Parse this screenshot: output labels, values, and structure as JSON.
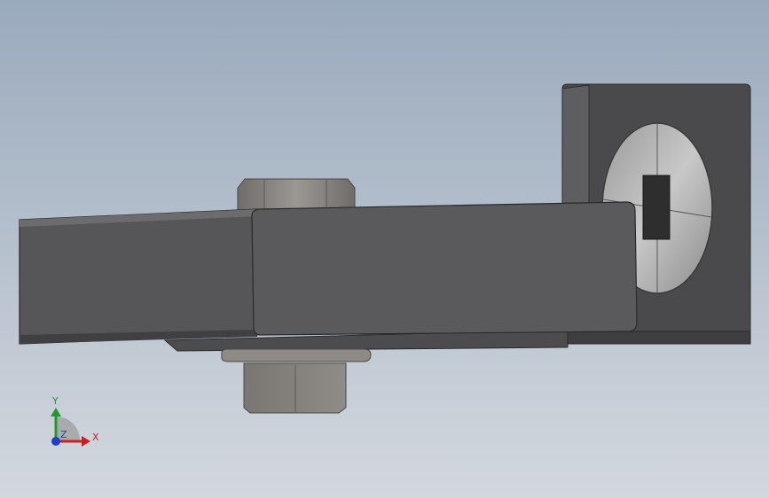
{
  "scene": {
    "background_top": "#9aaabd",
    "background_bottom": "#d3d8de",
    "model": {
      "parts": [
        "channel-beam",
        "angle-bracket",
        "hex-nut-top",
        "hex-nut-bottom",
        "washer",
        "bolt-head-slotted"
      ],
      "body_color": "#5a5a5c",
      "bracket_color": "#464648",
      "hardware_color": "#8a8784"
    }
  },
  "triad": {
    "x_label": "X",
    "y_label": "Y",
    "z_label": "Z",
    "x_color": "#cc1f1f",
    "y_color": "#1f9a2e",
    "z_color": "#1f3fcc"
  }
}
